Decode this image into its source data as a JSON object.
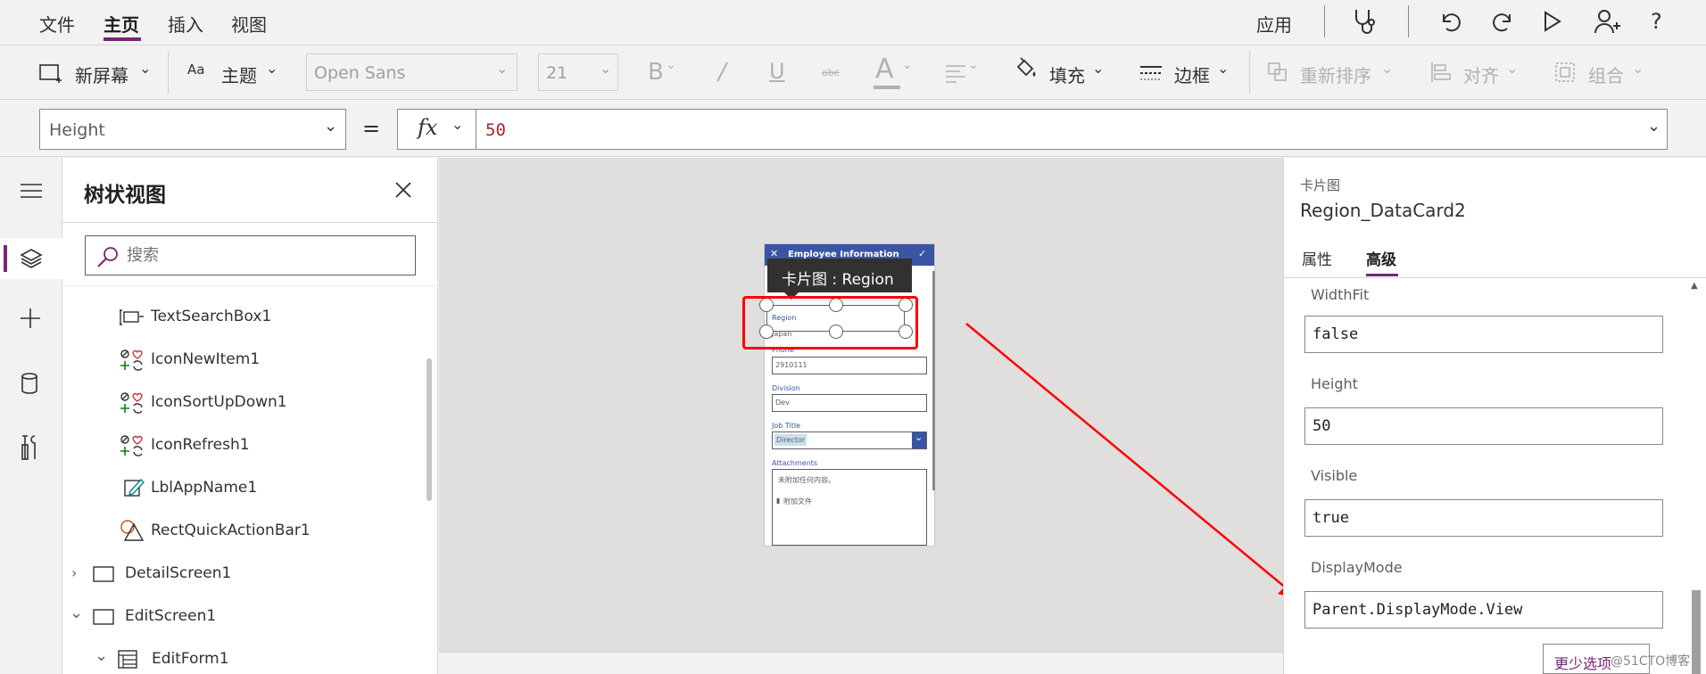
{
  "menu": {
    "items": [
      "文件",
      "主页",
      "插入",
      "视图"
    ],
    "active": "主页",
    "apply_label": "应用"
  },
  "ribbon": {
    "new_screen": "新屏幕",
    "theme": "主题",
    "font_family": "Open Sans",
    "font_size": "21",
    "bold_label": "B",
    "italic_label": "/",
    "underline_label": "U",
    "strike_label": "abc",
    "font_color_label": "A",
    "fill": "填充",
    "border": "边框",
    "reorder": "重新排序",
    "align": "对齐",
    "group": "组合"
  },
  "formula": {
    "property": "Height",
    "equals": "=",
    "fx": "fx",
    "value": "50"
  },
  "tree": {
    "title": "树状视图",
    "search_placeholder": "搜索",
    "items": [
      {
        "label": "TextSearchBox1",
        "icon": "textbox-icon"
      },
      {
        "label": "IconNewItem1",
        "icon": "icon-control-icon"
      },
      {
        "label": "IconSortUpDown1",
        "icon": "icon-control-icon"
      },
      {
        "label": "IconRefresh1",
        "icon": "icon-control-icon"
      },
      {
        "label": "LblAppName1",
        "icon": "label-edit-icon"
      },
      {
        "label": "RectQuickActionBar1",
        "icon": "shapes-icon"
      },
      {
        "label": "DetailScreen1",
        "icon": "screen-icon"
      },
      {
        "label": "EditScreen1",
        "icon": "screen-icon"
      },
      {
        "label": "EditForm1",
        "icon": "form-icon"
      }
    ]
  },
  "canvas": {
    "tooltip": "卡片图 : Region",
    "phone": {
      "header": "Employee Information",
      "fields": [
        {
          "label": "Region",
          "value": "Japan"
        },
        {
          "label": "Phone",
          "value": "2910111"
        },
        {
          "label": "Division",
          "value": "Dev"
        },
        {
          "label": "Job Title",
          "value": "Director"
        },
        {
          "label": "Attachments",
          "value": "未附加任何内容。"
        }
      ],
      "attach_link": "附加文件"
    }
  },
  "props": {
    "type_label": "卡片图",
    "name": "Region_DataCard2",
    "tabs": [
      "属性",
      "高级"
    ],
    "active_tab": "高级",
    "fields": [
      {
        "label": "WidthFit",
        "value": "false"
      },
      {
        "label": "Height",
        "value": "50"
      },
      {
        "label": "Visible",
        "value": "true"
      },
      {
        "label": "DisplayMode",
        "value": "Parent.DisplayMode.View"
      }
    ],
    "fewer_options": "更少选项"
  },
  "watermark": "@51CTO博客",
  "colors": {
    "accent": "#742774",
    "phone_header": "#3955a3",
    "highlight": "#ff0000"
  }
}
